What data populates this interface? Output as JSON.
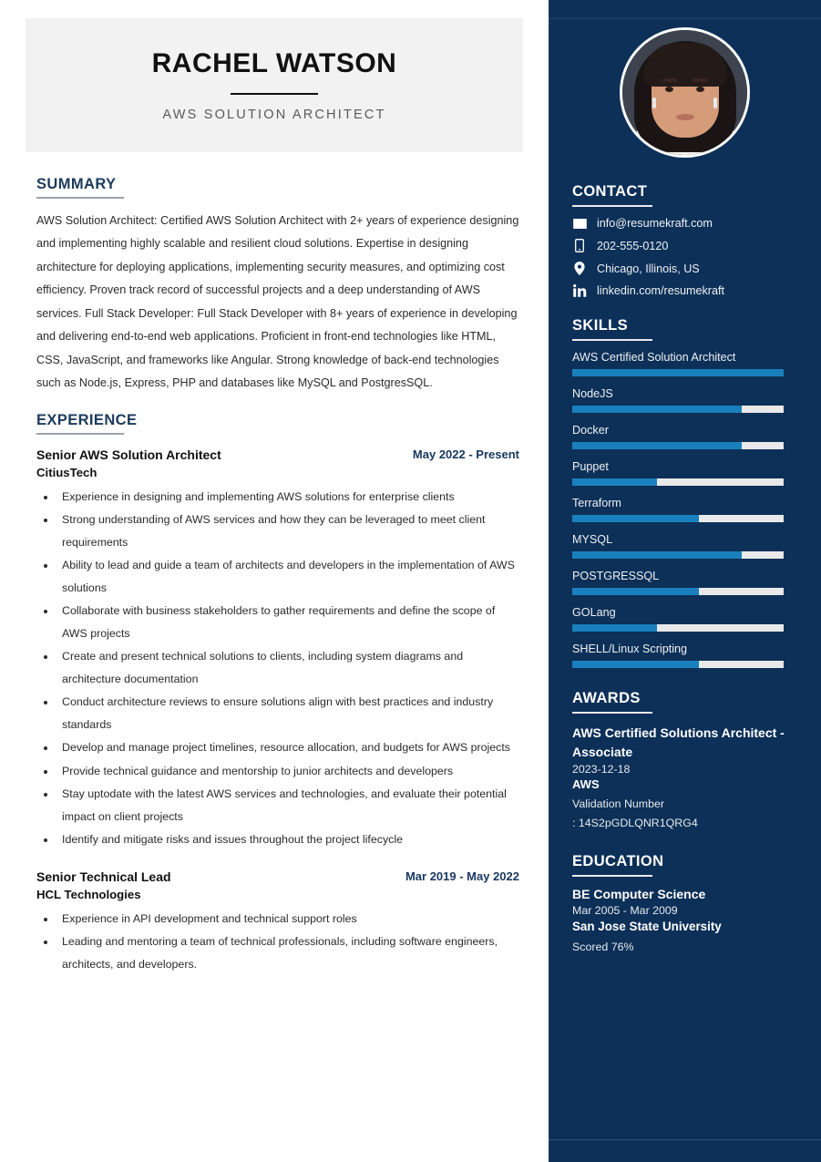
{
  "header": {
    "full_name": "RACHEL WATSON",
    "job_title": "AWS SOLUTION ARCHITECT"
  },
  "summary": {
    "heading": "SUMMARY",
    "text": "AWS Solution Architect: Certified AWS Solution Architect with 2+ years of experience designing and implementing highly scalable and resilient cloud solutions. Expertise in designing architecture for deploying applications, implementing security measures, and optimizing cost efficiency. Proven track record of successful projects and a deep understanding of AWS services. Full Stack Developer: Full Stack Developer with 8+ years of experience in developing and delivering end-to-end web applications. Proficient in front-end technologies like HTML, CSS, JavaScript, and frameworks like Angular. Strong knowledge of back-end technologies such as Node.js, Express, PHP and databases like MySQL and PostgresSQL."
  },
  "experience": {
    "heading": "EXPERIENCE",
    "jobs": [
      {
        "role": "Senior AWS Solution Architect",
        "company": "CitiusTech",
        "dates": "May 2022 - Present",
        "bullets": [
          "Experience in designing and implementing AWS solutions for enterprise clients",
          "Strong understanding of AWS services and how they can be leveraged to meet client requirements",
          "Ability to lead and guide a team of architects and developers in the implementation of AWS solutions",
          "Collaborate with business stakeholders to gather requirements and define the scope of AWS projects",
          "Create and present technical solutions to clients, including system diagrams and architecture documentation",
          "Conduct architecture reviews to ensure solutions align with best practices and industry standards",
          "Develop and manage project timelines, resource allocation, and budgets for AWS projects",
          "Provide technical guidance and mentorship to junior architects and developers",
          "Stay uptodate with the latest AWS services and technologies, and evaluate their potential impact on client projects",
          "Identify and mitigate risks and issues throughout the project lifecycle"
        ]
      },
      {
        "role": "Senior Technical Lead",
        "company": "HCL Technologies",
        "dates": "Mar 2019 - May 2022",
        "bullets": [
          "Experience in API development and technical support roles",
          "Leading and mentoring a team of technical professionals, including software engineers, architects, and developers."
        ]
      }
    ]
  },
  "contact": {
    "heading": "CONTACT",
    "items": [
      {
        "icon": "envelope-icon",
        "value": "info@resumekraft.com"
      },
      {
        "icon": "mobile-phone-icon",
        "value": "202-555-0120"
      },
      {
        "icon": "location-pin-icon",
        "value": "Chicago, Illinois, US"
      },
      {
        "icon": "linkedin-icon",
        "value": "linkedin.com/resumekraft"
      }
    ]
  },
  "skills": {
    "heading": "SKILLS",
    "items": [
      {
        "name": "AWS Certified Solution Architect",
        "level": 100
      },
      {
        "name": "NodeJS",
        "level": 80
      },
      {
        "name": "Docker",
        "level": 80
      },
      {
        "name": "Puppet",
        "level": 40
      },
      {
        "name": "Terraform",
        "level": 60
      },
      {
        "name": "MYSQL",
        "level": 80
      },
      {
        "name": "POSTGRESSQL",
        "level": 60
      },
      {
        "name": "GOLang",
        "level": 40
      },
      {
        "name": "SHELL/Linux Scripting",
        "level": 60
      }
    ]
  },
  "awards": {
    "heading": "AWARDS",
    "title": "AWS Certified Solutions Architect - Associate",
    "date": "2023-12-18",
    "issuer": "AWS",
    "validation_label": "Validation Number",
    "validation_number": ": 14S2pGDLQNR1QRG4"
  },
  "education": {
    "heading": "EDUCATION",
    "degree": "BE Computer Science",
    "dates": "Mar 2005 - Mar 2009",
    "school": "San Jose State University",
    "score": "Scored 76%"
  },
  "colors": {
    "sidebar_bg": "#0d3058",
    "accent_navy": "#17375e",
    "skill_fill": "#1a80bd",
    "skill_track": "#e9e9e9",
    "name_band_bg": "#f2f2f2"
  }
}
